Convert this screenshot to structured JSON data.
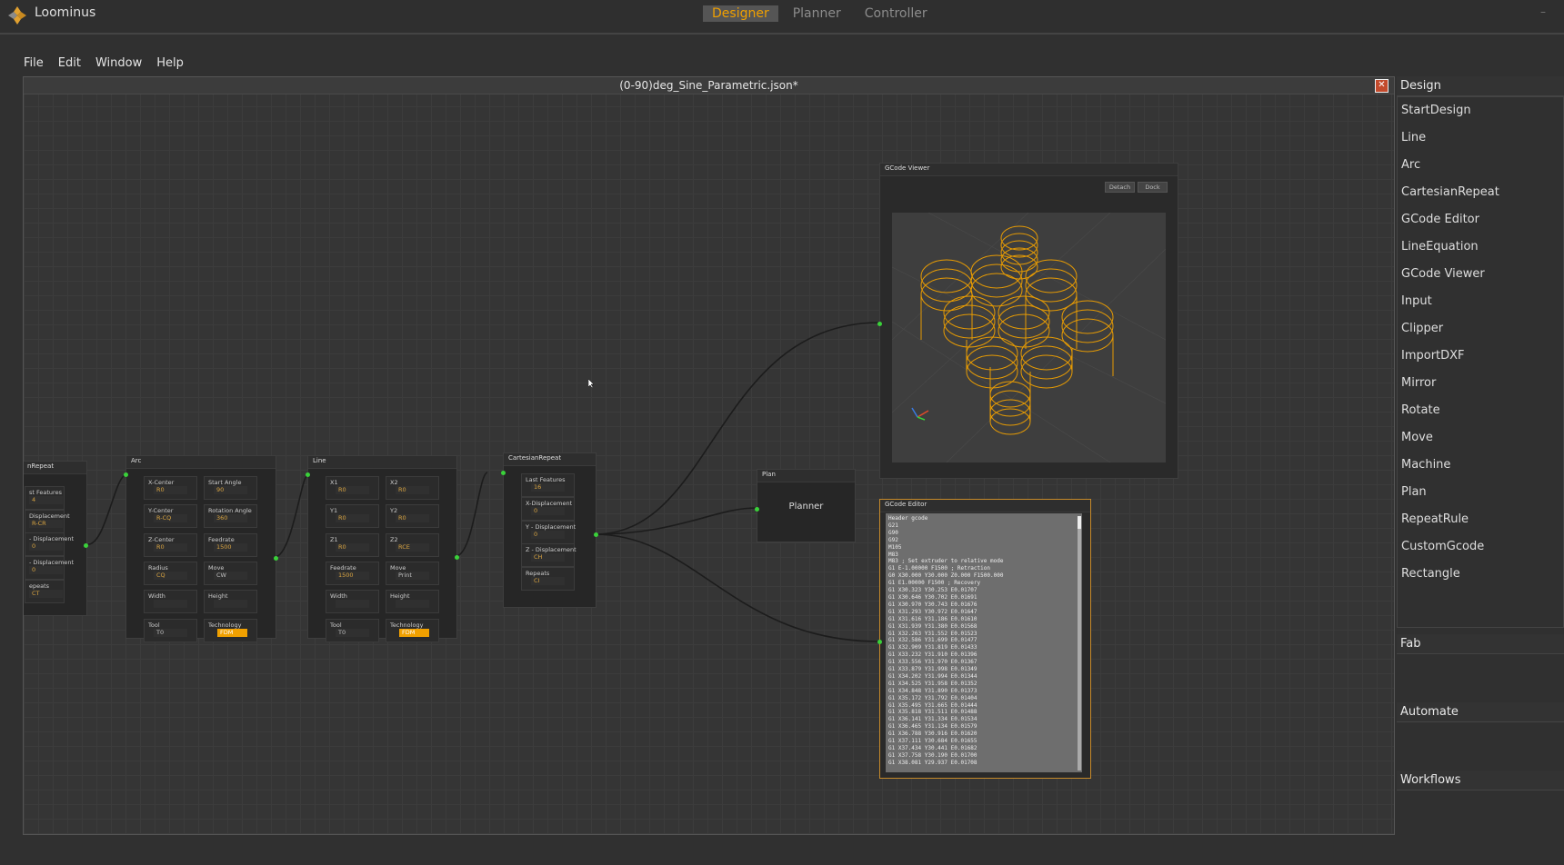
{
  "app": {
    "name": "Loominus",
    "modes": [
      "Designer",
      "Planner",
      "Controller"
    ],
    "active_mode": "Designer"
  },
  "menu": [
    "File",
    "Edit",
    "Window",
    "Help"
  ],
  "canvas": {
    "title": "(0-90)deg_Sine_Parametric.json*"
  },
  "nodes": {
    "cartesian_left": {
      "title": "nRepeat",
      "fields": [
        {
          "label": "st Features",
          "value": "4"
        },
        {
          "label": "Displacement",
          "value": "R-CR"
        },
        {
          "label": "- Displacement",
          "value": "0"
        },
        {
          "label": "- Displacement",
          "value": "0"
        },
        {
          "label": "epeats",
          "value": "CT"
        }
      ]
    },
    "arc": {
      "title": "Arc",
      "fields": [
        {
          "label": "X-Center",
          "value": "R0"
        },
        {
          "label": "Start Angle",
          "value": "90"
        },
        {
          "label": "Y-Center",
          "value": "R-CQ"
        },
        {
          "label": "Rotation Angle",
          "value": "360"
        },
        {
          "label": "Z-Center",
          "value": "R0"
        },
        {
          "label": "Feedrate",
          "value": "1500"
        },
        {
          "label": "Radius",
          "value": "CQ"
        },
        {
          "label": "Move",
          "value": "CW"
        },
        {
          "label": "Width",
          "value": ""
        },
        {
          "label": "Height",
          "value": ""
        },
        {
          "label": "Tool",
          "value": "T0"
        },
        {
          "label": "Technology",
          "value": "FDM"
        }
      ]
    },
    "line": {
      "title": "Line",
      "fields": [
        {
          "label": "X1",
          "value": "R0"
        },
        {
          "label": "X2",
          "value": "R0"
        },
        {
          "label": "Y1",
          "value": "R0"
        },
        {
          "label": "Y2",
          "value": "R0"
        },
        {
          "label": "Z1",
          "value": "R0"
        },
        {
          "label": "Z2",
          "value": "RCE"
        },
        {
          "label": "Feedrate",
          "value": "1500"
        },
        {
          "label": "Move",
          "value": "Print"
        },
        {
          "label": "Width",
          "value": ""
        },
        {
          "label": "Height",
          "value": ""
        },
        {
          "label": "Tool",
          "value": "T0"
        },
        {
          "label": "Technology",
          "value": "FDM"
        }
      ]
    },
    "cartesian": {
      "title": "CartesianRepeat",
      "fields": [
        {
          "label": "Last Features",
          "value": "16"
        },
        {
          "label": "X-Displacement",
          "value": "0"
        },
        {
          "label": "Y - Displacement",
          "value": "0"
        },
        {
          "label": "Z - Displacement",
          "value": "CH"
        },
        {
          "label": "Repeats",
          "value": "CI"
        }
      ]
    },
    "plan": {
      "title": "Plan",
      "label": "Planner"
    },
    "gcode_viewer": {
      "title": "GCode Viewer",
      "detach": "Detach",
      "dock": "Dock"
    },
    "gcode_editor": {
      "title": "GCode Editor",
      "lines": [
        "Header gcode",
        "G21",
        "G90",
        "G92",
        "M105",
        "M83",
        "M83 ; Set extruder to relative mode",
        "G1 E-1.00000 F1500 ; Retraction",
        "G0 X30.000 Y30.000 Z0.000 F1500.000",
        "G1 E1.00000 F1500 ; Recovery",
        "G1 X30.323 Y30.253 E0.01707",
        "G1 X30.646 Y30.702 E0.01691",
        "G1 X30.970 Y30.743 E0.01676",
        "G1 X31.293 Y30.972 E0.01647",
        "G1 X31.616 Y31.186 E0.01610",
        "G1 X31.939 Y31.380 E0.01568",
        "G1 X32.263 Y31.552 E0.01523",
        "G1 X32.586 Y31.699 E0.01477",
        "G1 X32.909 Y31.819 E0.01433",
        "G1 X33.232 Y31.910 E0.01396",
        "G1 X33.556 Y31.970 E0.01367",
        "G1 X33.879 Y31.998 E0.01349",
        "G1 X34.202 Y31.994 E0.01344",
        "G1 X34.525 Y31.958 E0.01352",
        "G1 X34.848 Y31.890 E0.01373",
        "G1 X35.172 Y31.792 E0.01404",
        "G1 X35.495 Y31.665 E0.01444",
        "G1 X35.818 Y31.511 E0.01488",
        "G1 X36.141 Y31.334 E0.01534",
        "G1 X36.465 Y31.134 E0.01579",
        "G1 X36.788 Y30.916 E0.01620",
        "G1 X37.111 Y30.684 E0.01655",
        "G1 X37.434 Y30.441 E0.01682",
        "G1 X37.758 Y30.190 E0.01700",
        "G1 X38.081 Y29.937 E0.01708"
      ]
    }
  },
  "sidebar": {
    "design_header": "Design",
    "items": [
      "StartDesign",
      "Line",
      "Arc",
      "CartesianRepeat",
      "GCode Editor",
      "LineEquation",
      "GCode Viewer",
      "Input",
      "Clipper",
      "ImportDXF",
      "Mirror",
      "Rotate",
      "Move",
      "Machine",
      "Plan",
      "RepeatRule",
      "CustomGcode",
      "Rectangle"
    ],
    "sections": [
      "Fab",
      "Automate",
      "Workflows"
    ]
  },
  "colors": {
    "accent": "#f0a000",
    "port": "#3ad13a",
    "close": "#c34a2c"
  }
}
